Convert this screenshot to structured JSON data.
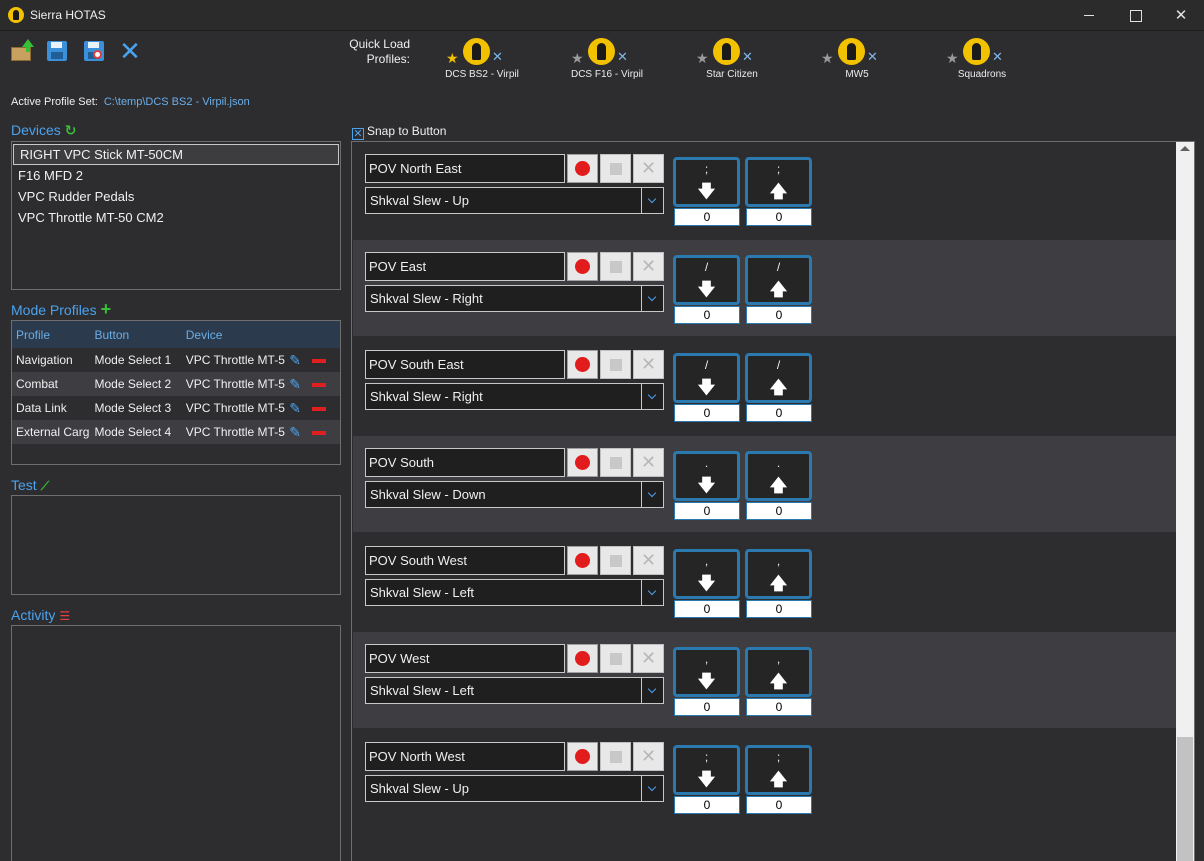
{
  "window": {
    "title": "Sierra HOTAS"
  },
  "toolbar": {
    "open": "open-icon",
    "save": "save-icon",
    "save_as": "save-as-icon",
    "close": "close-icon"
  },
  "quick_load": {
    "label_line1": "Quick Load",
    "label_line2": "Profiles:",
    "items": [
      {
        "name": "DCS BS2 - Virpil",
        "favorite": true
      },
      {
        "name": "DCS F16 - Virpil",
        "favorite": false
      },
      {
        "name": "Star Citizen",
        "favorite": false
      },
      {
        "name": "MW5",
        "favorite": false
      },
      {
        "name": "Squadrons",
        "favorite": false
      }
    ]
  },
  "active_profile": {
    "label": "Active Profile Set:",
    "path": "C:\\temp\\DCS BS2 - Virpil.json"
  },
  "devices": {
    "title": "Devices",
    "items": [
      "RIGHT VPC Stick MT-50CM",
      "F16 MFD 2",
      "VPC Rudder Pedals",
      "VPC Throttle MT-50 CM2"
    ],
    "selected": 0
  },
  "mode_profiles": {
    "title": "Mode Profiles",
    "columns": [
      "Profile",
      "Button",
      "Device"
    ],
    "rows": [
      {
        "profile": "Navigation",
        "button": "Mode Select 1",
        "device": "VPC Throttle MT-5"
      },
      {
        "profile": "Combat",
        "button": "Mode Select 2",
        "device": "VPC Throttle MT-5"
      },
      {
        "profile": "Data Link",
        "button": "Mode Select 3",
        "device": "VPC Throttle MT-5"
      },
      {
        "profile": "External Carg",
        "button": "Mode Select 4",
        "device": "VPC Throttle MT-5"
      }
    ]
  },
  "test": {
    "title": "Test"
  },
  "activity": {
    "title": "Activity"
  },
  "snap": {
    "label": "Snap to Button",
    "checked": true
  },
  "mappings": [
    {
      "name": "POV North East",
      "action": "Shkval Slew - Up",
      "down_key": ";",
      "up_key": ";",
      "down_value": "0",
      "up_value": "0"
    },
    {
      "name": "POV East",
      "action": "Shkval Slew - Right",
      "down_key": "/",
      "up_key": "/",
      "down_value": "0",
      "up_value": "0"
    },
    {
      "name": "POV South East",
      "action": "Shkval Slew - Right",
      "down_key": "/",
      "up_key": "/",
      "down_value": "0",
      "up_value": "0"
    },
    {
      "name": "POV South",
      "action": "Shkval Slew - Down",
      "down_key": ".",
      "up_key": ".",
      "down_value": "0",
      "up_value": "0"
    },
    {
      "name": "POV South West",
      "action": "Shkval Slew - Left",
      "down_key": ",",
      "up_key": ",",
      "down_value": "0",
      "up_value": "0"
    },
    {
      "name": "POV West",
      "action": "Shkval Slew - Left",
      "down_key": ",",
      "up_key": ",",
      "down_value": "0",
      "up_value": "0"
    },
    {
      "name": "POV North West",
      "action": "Shkval Slew - Up",
      "down_key": ";",
      "up_key": ";",
      "down_value": "0",
      "up_value": "0"
    }
  ],
  "colors": {
    "accent": "#4aa3f0",
    "record": "#e21c1c",
    "delete": "#e02020",
    "favorite": "#f2c200"
  }
}
